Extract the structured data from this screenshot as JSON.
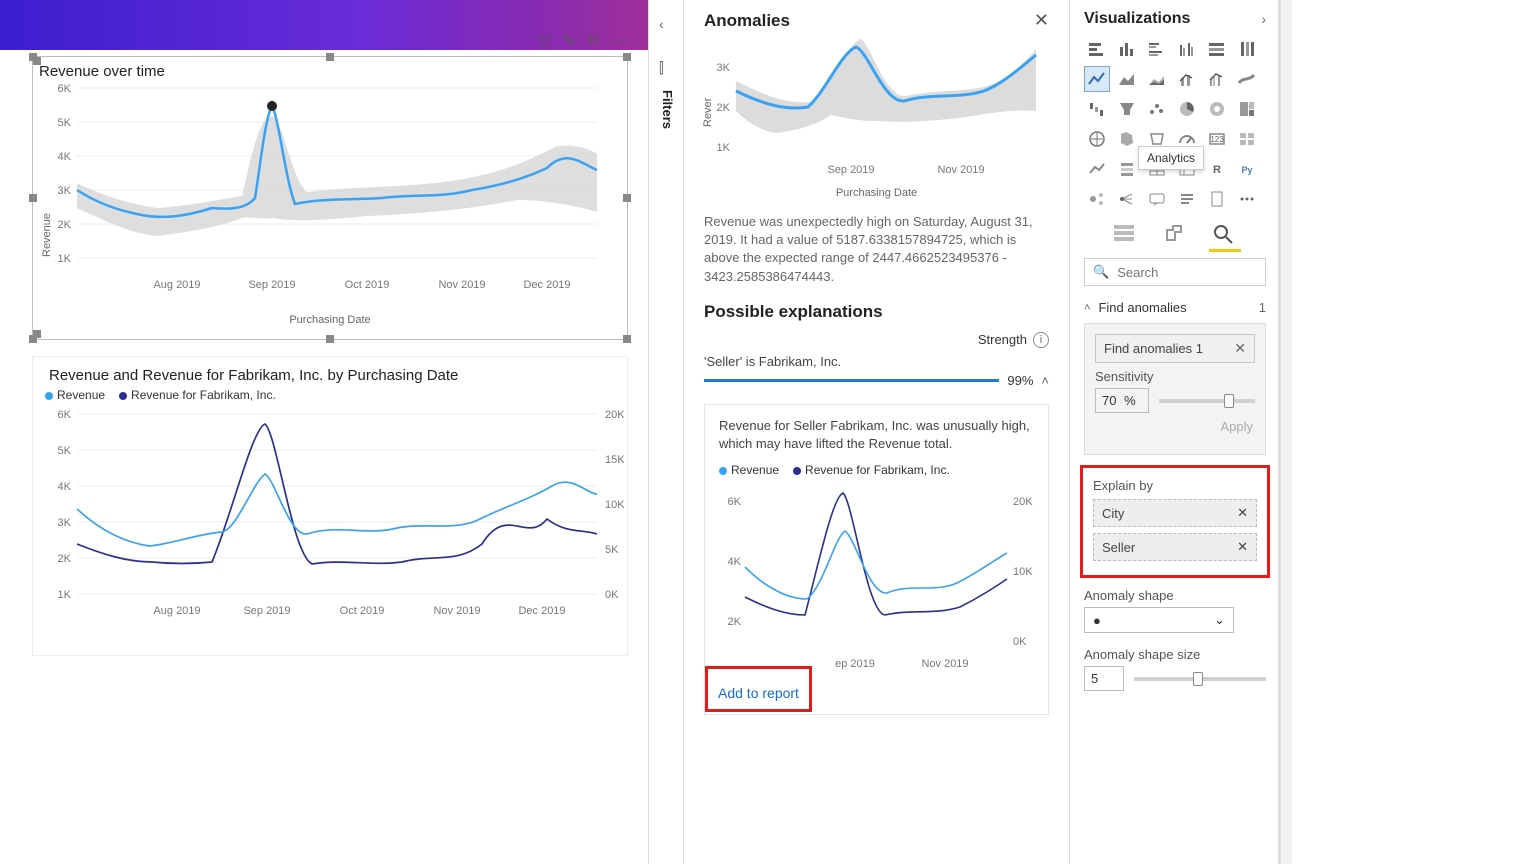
{
  "canvas": {
    "chart1": {
      "title": "Revenue over time",
      "ylabel": "Revenue",
      "xlabel": "Purchasing Date",
      "yTicks": [
        "1K",
        "2K",
        "3K",
        "4K",
        "5K",
        "6K"
      ],
      "xTicks": [
        "Aug 2019",
        "Sep 2019",
        "Oct 2019",
        "Nov 2019",
        "Dec 2019"
      ]
    },
    "chart2": {
      "title": "Revenue and Revenue for Fabrikam, Inc. by Purchasing Date",
      "legend1": "Revenue",
      "legend2": "Revenue for Fabrikam, Inc.",
      "yTicksL": [
        "1K",
        "2K",
        "3K",
        "4K",
        "5K",
        "6K"
      ],
      "yTicksR": [
        "0K",
        "5K",
        "10K",
        "15K",
        "20K"
      ],
      "xTicks": [
        "Aug 2019",
        "Sep 2019",
        "Oct 2019",
        "Nov 2019",
        "Dec 2019"
      ]
    }
  },
  "filters": {
    "label": "Filters"
  },
  "anomalies": {
    "title": "Anomalies",
    "chartYLabel": "Rever",
    "chartXLabel": "Purchasing Date",
    "chartYTicks": [
      "1K",
      "2K",
      "3K"
    ],
    "chartXTicks": [
      "Sep 2019",
      "Nov 2019"
    ],
    "description": "Revenue was unexpectedly high on Saturday, August 31, 2019. It had a value of 5187.6338157894725, which is above the expected range of 2447.4662523495376 - 3423.2585386474443.",
    "possibleTitle": "Possible explanations",
    "strengthLabel": "Strength",
    "explainLine": "'Seller' is Fabrikam, Inc.",
    "strengthPct": "99%",
    "cardText": "Revenue for Seller Fabrikam, Inc. was unusually high, which may have lifted the Revenue total.",
    "cardLegend1": "Revenue",
    "cardLegend2": "Revenue for Fabrikam, Inc.",
    "cardYTicksL": [
      "2K",
      "4K",
      "6K"
    ],
    "cardYTicksR": [
      "0K",
      "10K",
      "20K"
    ],
    "cardXTicks": [
      "ep 2019",
      "Nov 2019"
    ],
    "addToReport": "Add to report"
  },
  "viz": {
    "title": "Visualizations",
    "tooltip": "Analytics",
    "searchPlaceholder": "Search",
    "findAnomLabel": "Find anomalies",
    "findAnomCount": "1",
    "findAnomPill": "Find anomalies 1",
    "sensitivityLabel": "Sensitivity",
    "sensitivityVal": "70",
    "sensitivityUnit": "%",
    "applyLabel": "Apply",
    "explainByLabel": "Explain by",
    "explainPill1": "City",
    "explainPill2": "Seller",
    "shapeLabel": "Anomaly shape",
    "shapeSizeLabel": "Anomaly shape size",
    "shapeSizeVal": "5"
  },
  "chart_data": [
    {
      "type": "line",
      "title": "Revenue over time",
      "xlabel": "Purchasing Date",
      "ylabel": "Revenue",
      "ylim": [
        0,
        6
      ],
      "y_unit": "K",
      "x": [
        "2019-07-01",
        "2019-07-08",
        "2019-07-15",
        "2019-07-22",
        "2019-07-29",
        "2019-08-05",
        "2019-08-12",
        "2019-08-19",
        "2019-08-26",
        "2019-08-31",
        "2019-09-07",
        "2019-09-14",
        "2019-09-21",
        "2019-09-28",
        "2019-10-05",
        "2019-10-12",
        "2019-10-19",
        "2019-10-26",
        "2019-11-02",
        "2019-11-09",
        "2019-11-16",
        "2019-11-23",
        "2019-11-30",
        "2019-12-07",
        "2019-12-14",
        "2019-12-21",
        "2019-12-28"
      ],
      "series": [
        {
          "name": "Revenue",
          "values": [
            3.0,
            2.6,
            2.5,
            2.3,
            2.2,
            2.5,
            2.3,
            2.6,
            2.4,
            5.5,
            2.5,
            2.7,
            2.6,
            2.8,
            2.5,
            2.6,
            2.8,
            2.7,
            2.9,
            3.0,
            2.8,
            3.0,
            3.4,
            4.0,
            3.5,
            3.8,
            3.4
          ]
        },
        {
          "name": "ExpectedLow",
          "values": [
            2.4,
            2.1,
            2.0,
            1.8,
            1.8,
            2.0,
            1.9,
            2.1,
            2.0,
            2.2,
            2.0,
            2.2,
            2.1,
            2.3,
            2.0,
            2.1,
            2.3,
            2.2,
            2.4,
            2.5,
            2.3,
            2.5,
            2.8,
            3.3,
            2.9,
            3.1,
            2.8
          ]
        },
        {
          "name": "ExpectedHigh",
          "values": [
            3.5,
            3.1,
            3.0,
            2.8,
            2.7,
            3.0,
            2.8,
            3.1,
            2.9,
            3.4,
            3.0,
            3.2,
            3.1,
            3.3,
            3.0,
            3.1,
            3.3,
            3.2,
            3.4,
            3.5,
            3.3,
            3.5,
            3.9,
            4.6,
            4.1,
            4.4,
            4.0
          ]
        }
      ],
      "anomalies": [
        {
          "x": "2019-08-31",
          "y": 5.5
        }
      ]
    },
    {
      "type": "line",
      "title": "Revenue and Revenue for Fabrikam, Inc. by Purchasing Date",
      "xlabel": "Purchasing Date",
      "ylim_left": [
        0,
        6
      ],
      "ylim_right": [
        0,
        20
      ],
      "y_unit": "K",
      "x": [
        "2019-07-01",
        "2019-07-15",
        "2019-08-01",
        "2019-08-15",
        "2019-08-31",
        "2019-09-15",
        "2019-10-01",
        "2019-10-15",
        "2019-11-01",
        "2019-11-15",
        "2019-12-01",
        "2019-12-15",
        "2019-12-31"
      ],
      "series": [
        {
          "name": "Revenue",
          "axis": "left",
          "values": [
            3.4,
            2.6,
            2.2,
            2.4,
            5.9,
            2.6,
            2.8,
            2.6,
            2.9,
            3.0,
            3.5,
            4.0,
            3.4
          ]
        },
        {
          "name": "Revenue for Fabrikam, Inc.",
          "axis": "right",
          "values": [
            7,
            6,
            5,
            5,
            19,
            6,
            5,
            6,
            6,
            7,
            12,
            10,
            8
          ]
        }
      ]
    }
  ]
}
